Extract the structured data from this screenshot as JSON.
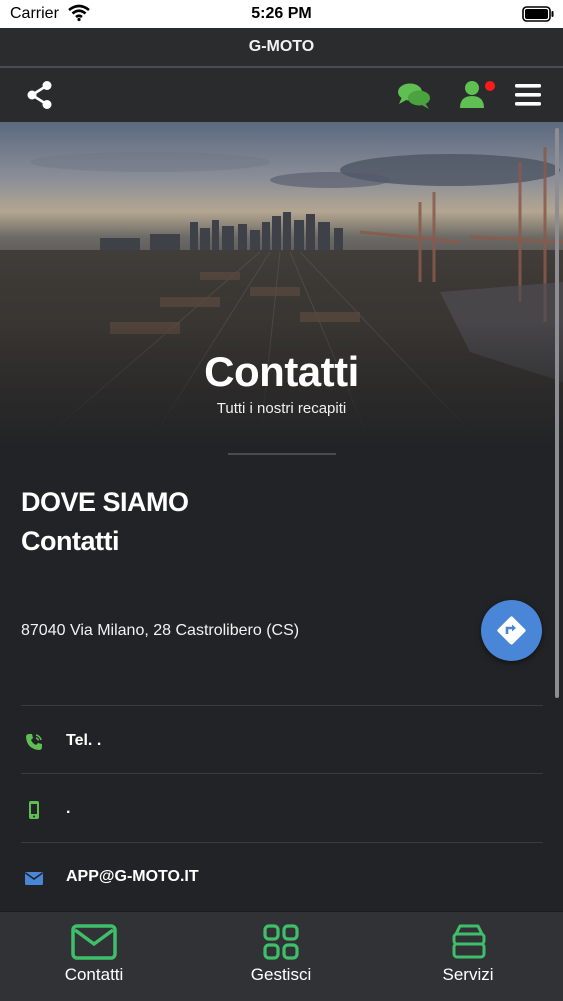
{
  "status_bar": {
    "carrier": "Carrier",
    "time": "5:26 PM"
  },
  "app": {
    "title": "G-MOTO"
  },
  "toolbar": {
    "share_icon": "share-icon",
    "chat_icon": "chat-icon",
    "user_icon": "user-icon",
    "menu_icon": "hamburger-menu-icon",
    "notification_dot_color": "#ff1a1a",
    "accent_green": "#5fbf52"
  },
  "hero": {
    "title": "Contatti",
    "subtitle": "Tutti i nostri recapiti"
  },
  "section": {
    "heading1": "DOVE SIAMO",
    "heading2": "Contatti",
    "address": "87040 Via Milano, 28 Castrolibero (CS)",
    "directions_icon": "directions-icon",
    "fab_color": "#4a86d8"
  },
  "contacts": [
    {
      "icon": "phone-icon",
      "text": "Tel. ."
    },
    {
      "icon": "mobile-icon",
      "text": "."
    },
    {
      "icon": "mail-icon",
      "text": "APP@G-MOTO.IT"
    }
  ],
  "tabs": [
    {
      "icon": "mail-icon",
      "label": "Contatti"
    },
    {
      "icon": "grid-icon",
      "label": "Gestisci"
    },
    {
      "icon": "layers-icon",
      "label": "Servizi"
    }
  ]
}
